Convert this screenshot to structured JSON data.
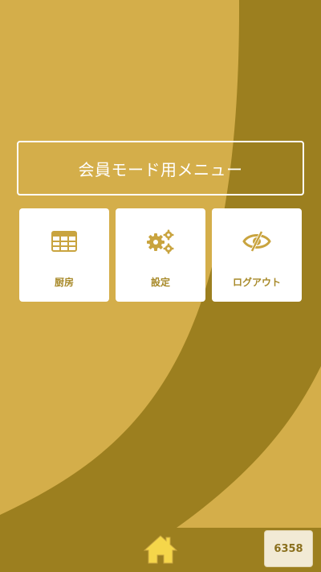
{
  "menu": {
    "title": "会員モード用メニュー"
  },
  "tiles": [
    {
      "label": "厨房",
      "icon": "table-grid-icon"
    },
    {
      "label": "設定",
      "icon": "gears-icon"
    },
    {
      "label": "ログアウト",
      "icon": "eye-slash-icon"
    }
  ],
  "footer": {
    "home_icon": "home-icon",
    "badge_text": "6358"
  },
  "colors": {
    "background": "#d4ae4a",
    "accent_dark": "#9c7f1f",
    "tile_background": "#ffffff",
    "icon_color": "#c9a43f",
    "label_color": "#a88a2a",
    "home_icon_color": "#f5d64a",
    "badge_background": "#f2ead5"
  }
}
